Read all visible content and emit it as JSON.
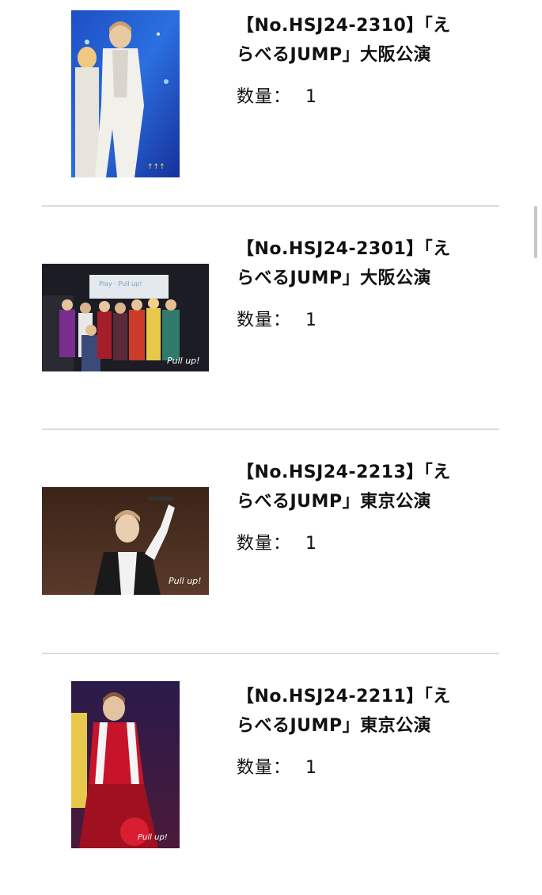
{
  "products": [
    {
      "title_line1": "【No.HSJ24-2310】「え",
      "title_line2": "らべるJUMP」大阪公演",
      "qty_label": "数量：",
      "qty_value": "1"
    },
    {
      "title_line1": "【No.HSJ24-2301】「え",
      "title_line2": "らべるJUMP」大阪公演",
      "qty_label": "数量：",
      "qty_value": "1"
    },
    {
      "title_line1": "【No.HSJ24-2213】「え",
      "title_line2": "らべるJUMP」東京公演",
      "qty_label": "数量：",
      "qty_value": "1"
    },
    {
      "title_line1": "【No.HSJ24-2211】「え",
      "title_line2": "らべるJUMP」東京公演",
      "qty_label": "数量：",
      "qty_value": "1"
    }
  ],
  "colors": {
    "divider": "#dcdcdc",
    "text": "#111111",
    "scrollbar": "#c8c8c8"
  }
}
